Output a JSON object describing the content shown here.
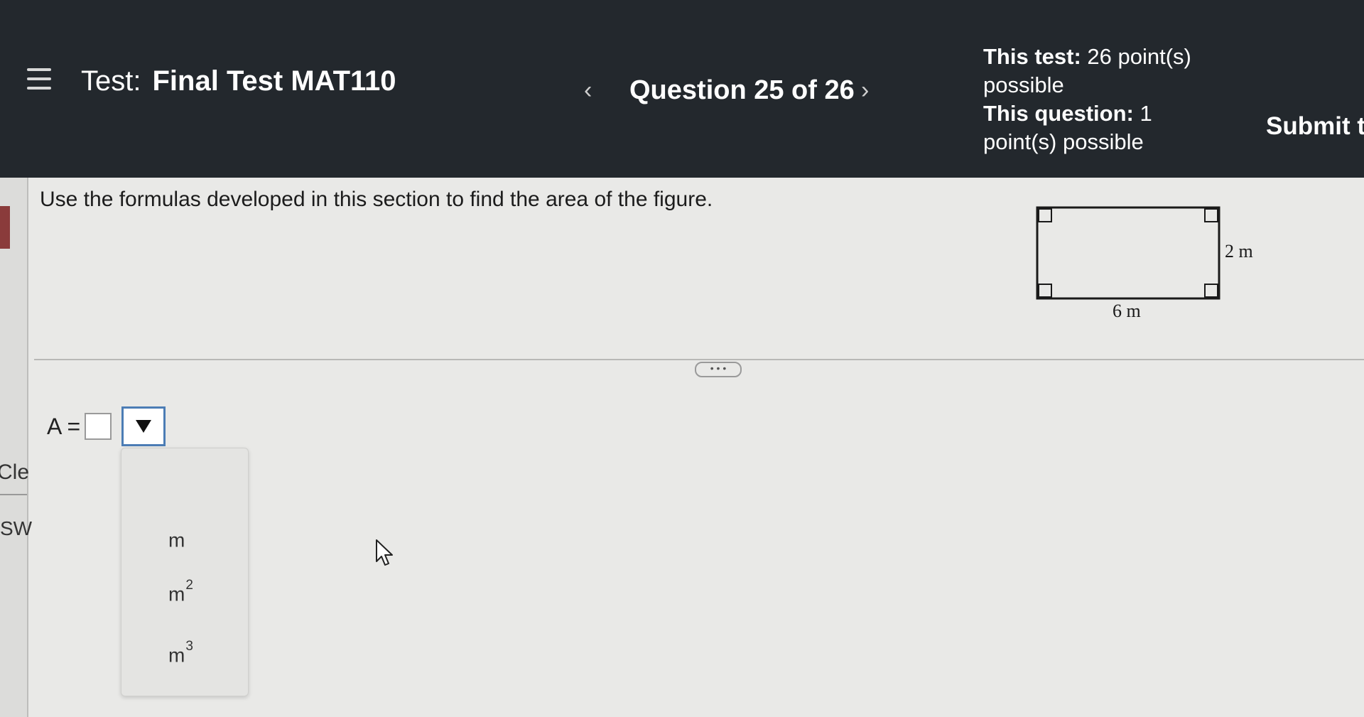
{
  "header": {
    "menu_icon": "hamburger-icon",
    "test_prefix": "Test:",
    "test_name": "Final Test MAT110",
    "prev_glyph": "‹",
    "question_counter": "Question 25 of 26",
    "next_glyph": "›",
    "this_test_label": "This test:",
    "this_test_value": "26 point(s) possible",
    "this_question_label": "This question:",
    "this_question_value": "1 point(s) possible",
    "submit_label": "Submit te"
  },
  "left_strip": {
    "clear_label": "Cle",
    "show_label": "SW"
  },
  "question": {
    "prompt": "Use the formulas developed in this section to find the area of the figure.",
    "figure": {
      "width_label": "6 m",
      "height_label": "2 m"
    }
  },
  "expander_label": "• • •",
  "answer": {
    "label": "A =",
    "value": "",
    "unit_options": [
      {
        "base": "m",
        "exp": ""
      },
      {
        "base": "m",
        "exp": "2"
      },
      {
        "base": "m",
        "exp": "3"
      }
    ]
  }
}
